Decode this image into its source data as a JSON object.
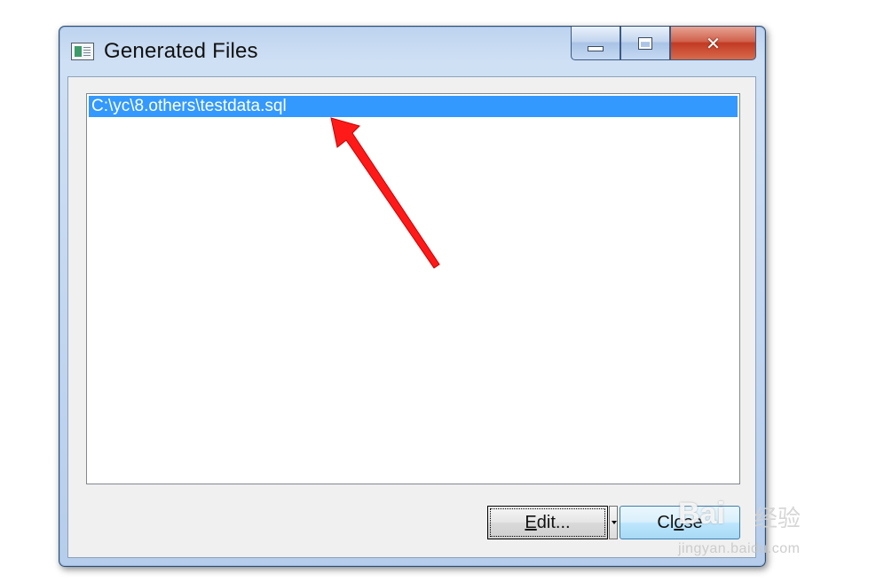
{
  "window": {
    "title": "Generated Files",
    "icon": "app-window-icon",
    "caption_buttons": {
      "minimize": "minimize-icon",
      "maximize": "maximize-icon",
      "close": "close-icon"
    }
  },
  "file_list": {
    "items": [
      {
        "label": "C:\\yc\\8.others\\testdata.sql",
        "selected": true
      }
    ]
  },
  "buttons": {
    "edit": {
      "label_accel": "E",
      "label_rest": "dit..."
    },
    "close": {
      "label_pre": "Cl",
      "label_accel": "o",
      "label_rest": "se"
    }
  },
  "colors": {
    "selection": "#3399ff",
    "annotation_arrow": "#ff1a1a"
  },
  "watermark": {
    "brand": "Bai",
    "brand_cn": "经验",
    "url": "jingyan.baidu.com"
  }
}
